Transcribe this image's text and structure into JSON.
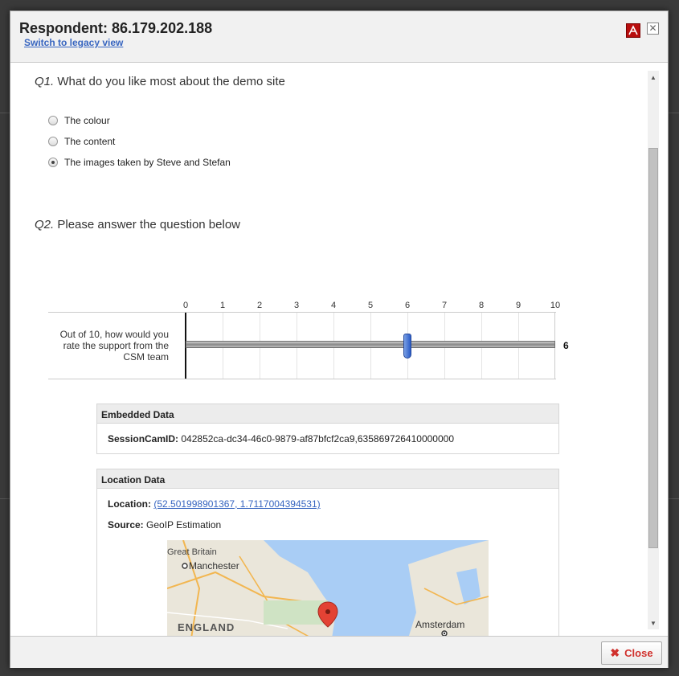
{
  "dialog": {
    "title": "Respondent: 86.179.202.188",
    "legacy_link": "Switch to legacy view",
    "close_x": "✕",
    "pdf_icon": "pdf-icon"
  },
  "q1": {
    "number": "Q1.",
    "text": "What do you like most about the demo site",
    "options": [
      {
        "label": "The colour",
        "checked": false
      },
      {
        "label": "The content",
        "checked": false
      },
      {
        "label": "The images taken by Steve and Stefan",
        "checked": true
      }
    ]
  },
  "q2": {
    "number": "Q2.",
    "text": "Please answer the question below",
    "ticks": [
      "0",
      "1",
      "2",
      "3",
      "4",
      "5",
      "6",
      "7",
      "8",
      "9",
      "10"
    ],
    "row_label": "Out of 10, how would you rate the support from the CSM team",
    "value": 6,
    "value_text": "6"
  },
  "embedded": {
    "heading": "Embedded Data",
    "key": "SessionCamID:",
    "value": "042852ca-dc34-46c0-9879-af87bfcf2ca9,635869726410000000"
  },
  "location": {
    "heading": "Location Data",
    "location_key": "Location:",
    "location_value": "(52.501998901367, 1.7117004394531)",
    "source_key": "Source:",
    "source_value": "GeoIP Estimation",
    "map_labels": {
      "region1": "Great Britain",
      "city1": "Manchester",
      "region2": "ENGLAND",
      "city2": "Amsterdam"
    }
  },
  "footer": {
    "close_label": "Close"
  }
}
